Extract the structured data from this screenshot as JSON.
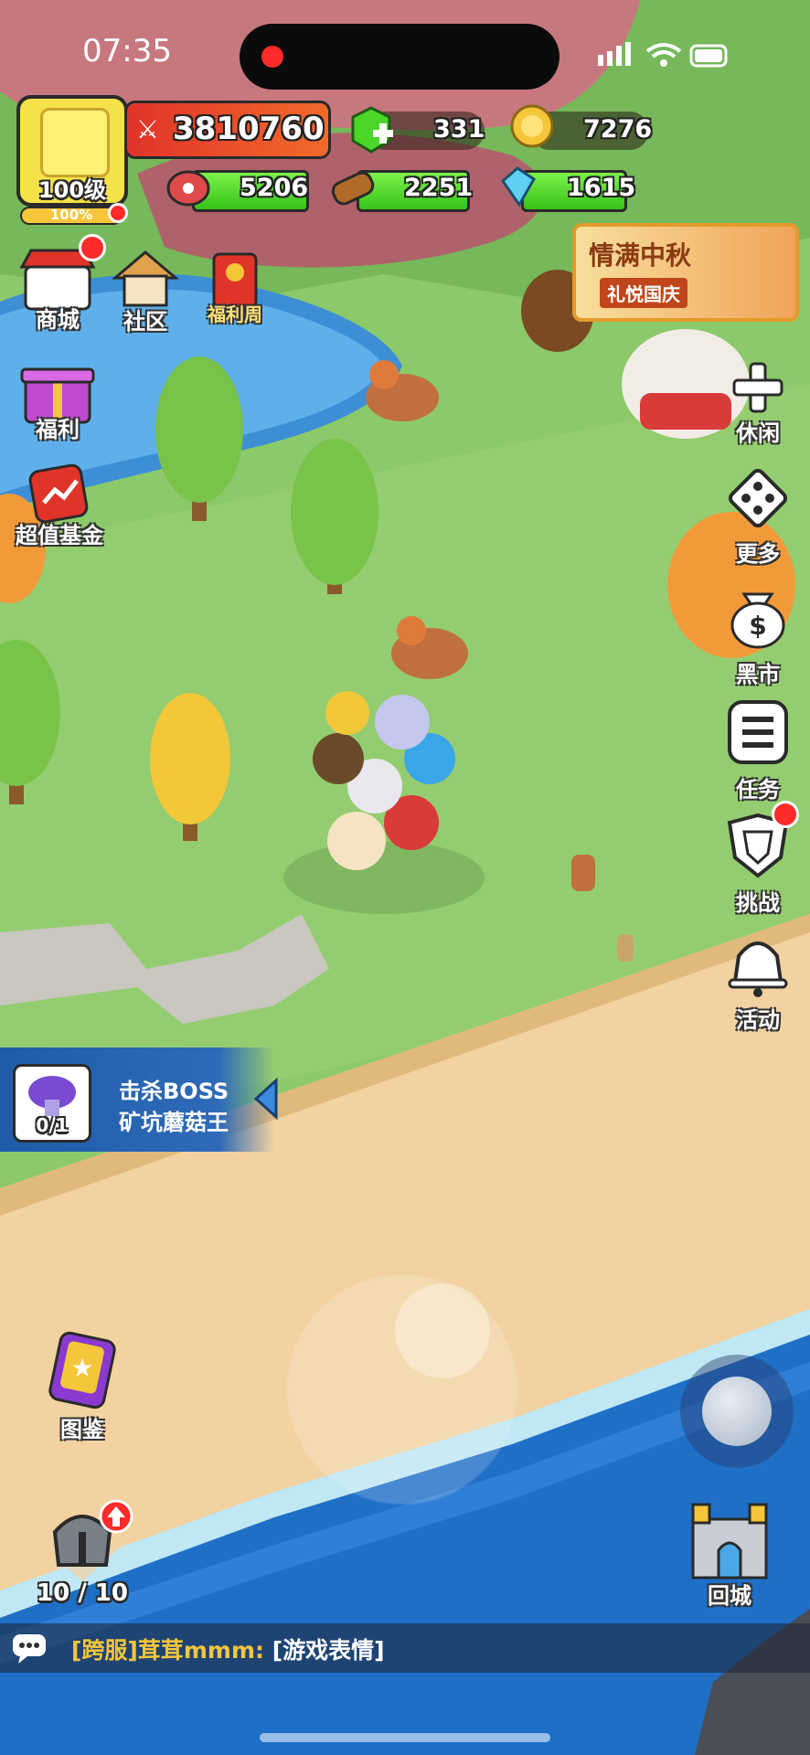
{
  "status": {
    "time": "07:35"
  },
  "player": {
    "level_label": "100级",
    "exp_percent": "100%",
    "power": "3810760"
  },
  "currencies": {
    "gems": "331",
    "gold": "7276"
  },
  "resources": {
    "meat": "5206",
    "wood": "2251",
    "crystal": "1615"
  },
  "left_menu": {
    "shop": "商城",
    "community": "社区",
    "welfare_week": "福利周",
    "welfare": "福利",
    "fund": "超值基金",
    "codex": "图鉴"
  },
  "right_menu": {
    "leisure": "休闲",
    "more": "更多",
    "black_market": "黑市",
    "tasks": "任务",
    "challenge": "挑战",
    "events": "活动",
    "return_city": "回城"
  },
  "event_banner": {
    "title": "情满中秋",
    "subtitle": "礼悦国庆"
  },
  "quest": {
    "line1": "击杀BOSS",
    "line2": "矿坑蘑菇王",
    "progress": "0/1"
  },
  "heroes": {
    "count": "10 / 10"
  },
  "chat": {
    "channel": "[跨服]",
    "sender": "茸茸mmm:",
    "message": "[游戏表情]"
  },
  "colors": {
    "grass": "#8cc96a",
    "sand": "#f2d2a0",
    "sea": "#1f6fc7",
    "accent_red": "#ff2a2a",
    "hp_green": "#4bd62a"
  },
  "exp_fill": 1.0
}
